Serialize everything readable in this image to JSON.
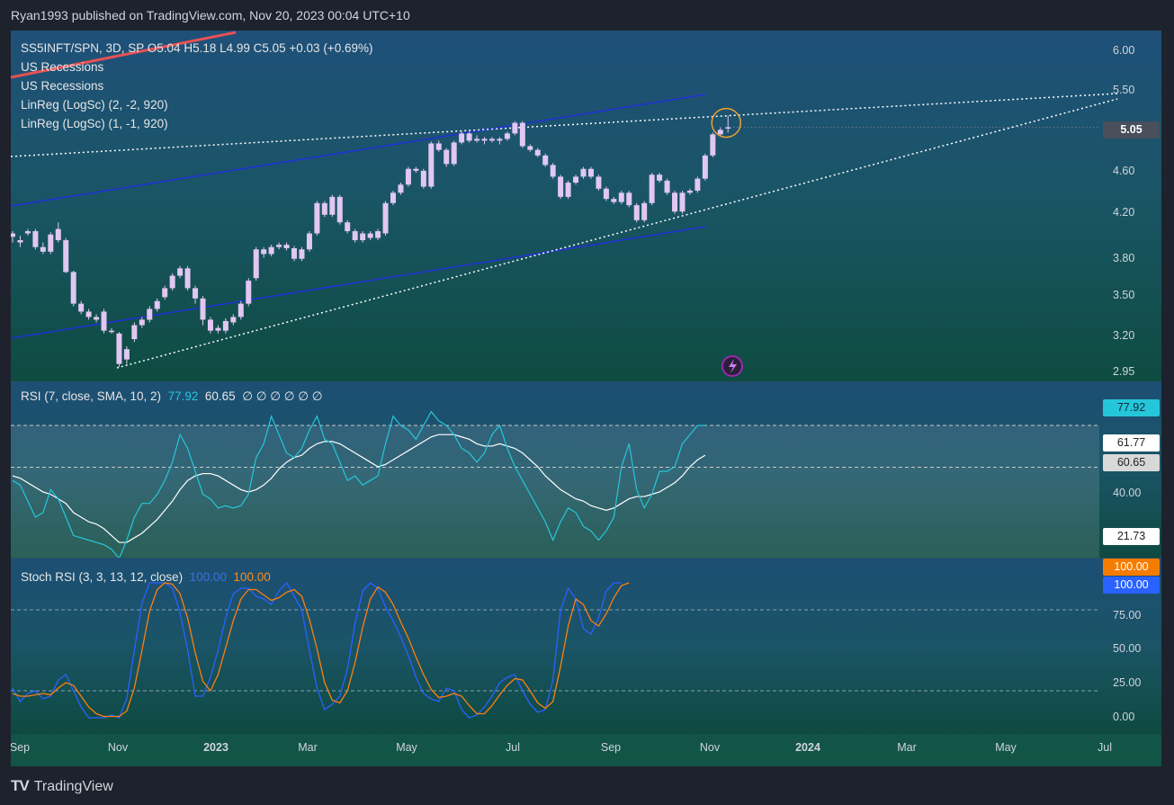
{
  "header": {
    "publisher_line": "Ryan1993 published on TradingView.com, Nov 20, 2023 00:04 UTC+10"
  },
  "footer": {
    "brand": "TradingView",
    "brand_icon": "tradingview-logo-icon"
  },
  "colors": {
    "candle": "#e1c7f2",
    "channel": "#2130d8",
    "trend": "#ffffff",
    "rsi": "#26c6da",
    "rsi_ma": "#ffffff",
    "stoch_k": "#2962ff",
    "stoch_d": "#ff7f0e",
    "recession": "#ff5252"
  },
  "price_legend": {
    "line1": "SS5INFT/SPN, 3D, SP  O5.04  H5.18  L4.99  C5.05  +0.03 (+0.69%)",
    "line2": "US Recessions",
    "line3": "US Recessions",
    "line4": "LinReg (LogSc) (2, -2, 920)",
    "line5": "LinReg (LogSc) (1, -1, 920)"
  },
  "rsi_legend": {
    "name": "RSI (7, close, SMA, 10, 2)",
    "v1": "77.92",
    "v2": "60.65",
    "rest": "∅  ∅  ∅  ∅  ∅  ∅"
  },
  "stoch_legend": {
    "name": "Stoch RSI (3, 3, 13, 12, close)",
    "v1": "100.00",
    "v2": "100.00"
  },
  "x_axis": [
    "Sep",
    "Nov",
    "2023",
    "Mar",
    "May",
    "Jul",
    "Sep",
    "Nov",
    "2024",
    "Mar",
    "May",
    "Jul"
  ],
  "price_axis": [
    "6.00",
    "5.50",
    "4.60",
    "4.20",
    "3.80",
    "3.50",
    "3.20",
    "2.95"
  ],
  "price_badge": "5.05",
  "rsi_axis": [
    "40.00"
  ],
  "rsi_badges": [
    "77.92",
    "61.77",
    "60.65",
    "21.73"
  ],
  "stoch_axis": [
    "75.00",
    "50.00",
    "25.00",
    "0.00"
  ],
  "stoch_badges": [
    "100.00",
    "100.00"
  ],
  "chart_data": [
    {
      "type": "candlestick",
      "title": "SS5INFT/SPN, 3D, SP",
      "scale": "log",
      "ylim": [
        2.9,
        6.2
      ],
      "candles": [
        {
          "o": 3.95,
          "c": 3.98,
          "h": 4.0,
          "l": 3.9
        },
        {
          "o": 3.92,
          "c": 3.9,
          "h": 3.96,
          "l": 3.86
        },
        {
          "o": 3.98,
          "c": 4.0,
          "h": 4.02,
          "l": 3.96
        },
        {
          "o": 4.0,
          "c": 3.86,
          "h": 4.02,
          "l": 3.84
        },
        {
          "o": 3.86,
          "c": 3.82,
          "h": 3.9,
          "l": 3.8
        },
        {
          "o": 3.82,
          "c": 3.97,
          "h": 3.99,
          "l": 3.8
        },
        {
          "o": 4.02,
          "c": 3.92,
          "h": 4.08,
          "l": 3.9
        },
        {
          "o": 3.92,
          "c": 3.65,
          "h": 3.94,
          "l": 3.64
        },
        {
          "o": 3.65,
          "c": 3.4,
          "h": 3.66,
          "l": 3.38
        },
        {
          "o": 3.4,
          "c": 3.34,
          "h": 3.42,
          "l": 3.32
        },
        {
          "o": 3.34,
          "c": 3.3,
          "h": 3.36,
          "l": 3.28
        },
        {
          "o": 3.3,
          "c": 3.28,
          "h": 3.32,
          "l": 3.26
        },
        {
          "o": 3.34,
          "c": 3.2,
          "h": 3.36,
          "l": 3.18
        },
        {
          "o": 3.2,
          "c": 3.19,
          "h": 3.22,
          "l": 3.18
        },
        {
          "o": 3.18,
          "c": 2.97,
          "h": 3.19,
          "l": 2.95
        },
        {
          "o": 3.0,
          "c": 3.07,
          "h": 3.09,
          "l": 2.97
        },
        {
          "o": 3.14,
          "c": 3.24,
          "h": 3.26,
          "l": 3.12
        },
        {
          "o": 3.24,
          "c": 3.28,
          "h": 3.3,
          "l": 3.22
        },
        {
          "o": 3.28,
          "c": 3.36,
          "h": 3.38,
          "l": 3.26
        },
        {
          "o": 3.36,
          "c": 3.42,
          "h": 3.44,
          "l": 3.34
        },
        {
          "o": 3.45,
          "c": 3.52,
          "h": 3.54,
          "l": 3.43
        },
        {
          "o": 3.52,
          "c": 3.62,
          "h": 3.64,
          "l": 3.5
        },
        {
          "o": 3.62,
          "c": 3.68,
          "h": 3.7,
          "l": 3.6
        },
        {
          "o": 3.68,
          "c": 3.52,
          "h": 3.7,
          "l": 3.5
        },
        {
          "o": 3.52,
          "c": 3.44,
          "h": 3.54,
          "l": 3.4
        },
        {
          "o": 3.44,
          "c": 3.28,
          "h": 3.46,
          "l": 3.24
        },
        {
          "o": 3.28,
          "c": 3.2,
          "h": 3.3,
          "l": 3.18
        },
        {
          "o": 3.2,
          "c": 3.22,
          "h": 3.24,
          "l": 3.18
        },
        {
          "o": 3.2,
          "c": 3.27,
          "h": 3.29,
          "l": 3.18
        },
        {
          "o": 3.26,
          "c": 3.3,
          "h": 3.32,
          "l": 3.24
        },
        {
          "o": 3.3,
          "c": 3.4,
          "h": 3.42,
          "l": 3.28
        },
        {
          "o": 3.4,
          "c": 3.58,
          "h": 3.6,
          "l": 3.38
        },
        {
          "o": 3.6,
          "c": 3.84,
          "h": 3.86,
          "l": 3.58
        },
        {
          "o": 3.84,
          "c": 3.8,
          "h": 3.86,
          "l": 3.77
        },
        {
          "o": 3.8,
          "c": 3.86,
          "h": 3.88,
          "l": 3.78
        },
        {
          "o": 3.86,
          "c": 3.88,
          "h": 3.9,
          "l": 3.84
        },
        {
          "o": 3.88,
          "c": 3.85,
          "h": 3.9,
          "l": 3.83
        },
        {
          "o": 3.85,
          "c": 3.76,
          "h": 3.87,
          "l": 3.74
        },
        {
          "o": 3.76,
          "c": 3.84,
          "h": 3.86,
          "l": 3.74
        },
        {
          "o": 3.84,
          "c": 3.98,
          "h": 4.0,
          "l": 3.82
        },
        {
          "o": 3.98,
          "c": 4.26,
          "h": 4.28,
          "l": 3.96
        },
        {
          "o": 4.26,
          "c": 4.15,
          "h": 4.28,
          "l": 4.13
        },
        {
          "o": 4.15,
          "c": 4.32,
          "h": 4.34,
          "l": 4.13
        },
        {
          "o": 4.32,
          "c": 4.08,
          "h": 4.34,
          "l": 4.06
        },
        {
          "o": 4.08,
          "c": 4.0,
          "h": 4.1,
          "l": 3.98
        },
        {
          "o": 4.0,
          "c": 3.92,
          "h": 4.02,
          "l": 3.9
        },
        {
          "o": 3.92,
          "c": 3.98,
          "h": 4.0,
          "l": 3.9
        },
        {
          "o": 3.98,
          "c": 3.94,
          "h": 4.0,
          "l": 3.92
        },
        {
          "o": 3.94,
          "c": 4.0,
          "h": 4.02,
          "l": 3.92
        },
        {
          "o": 3.98,
          "c": 4.26,
          "h": 4.28,
          "l": 3.96
        },
        {
          "o": 4.26,
          "c": 4.36,
          "h": 4.38,
          "l": 4.24
        },
        {
          "o": 4.36,
          "c": 4.44,
          "h": 4.46,
          "l": 4.34
        },
        {
          "o": 4.44,
          "c": 4.6,
          "h": 4.62,
          "l": 4.42
        },
        {
          "o": 4.6,
          "c": 4.58,
          "h": 4.62,
          "l": 4.56
        },
        {
          "o": 4.58,
          "c": 4.42,
          "h": 4.6,
          "l": 4.4
        },
        {
          "o": 4.42,
          "c": 4.87,
          "h": 4.89,
          "l": 4.4
        },
        {
          "o": 4.87,
          "c": 4.8,
          "h": 4.9,
          "l": 4.78
        },
        {
          "o": 4.8,
          "c": 4.65,
          "h": 4.82,
          "l": 4.62
        },
        {
          "o": 4.65,
          "c": 4.88,
          "h": 4.9,
          "l": 4.63
        },
        {
          "o": 4.88,
          "c": 4.98,
          "h": 5.0,
          "l": 4.86
        },
        {
          "o": 4.98,
          "c": 4.9,
          "h": 5.0,
          "l": 4.88
        },
        {
          "o": 4.9,
          "c": 4.92,
          "h": 4.96,
          "l": 4.88
        },
        {
          "o": 4.92,
          "c": 4.9,
          "h": 4.94,
          "l": 4.86
        },
        {
          "o": 4.9,
          "c": 4.92,
          "h": 4.94,
          "l": 4.88
        },
        {
          "o": 4.92,
          "c": 4.9,
          "h": 4.94,
          "l": 4.86
        },
        {
          "o": 4.92,
          "c": 4.98,
          "h": 5.0,
          "l": 4.9
        },
        {
          "o": 4.98,
          "c": 5.1,
          "h": 5.12,
          "l": 4.96
        },
        {
          "o": 5.1,
          "c": 4.84,
          "h": 5.12,
          "l": 4.82
        },
        {
          "o": 4.84,
          "c": 4.8,
          "h": 4.86,
          "l": 4.78
        },
        {
          "o": 4.8,
          "c": 4.74,
          "h": 4.82,
          "l": 4.72
        },
        {
          "o": 4.74,
          "c": 4.64,
          "h": 4.76,
          "l": 4.62
        },
        {
          "o": 4.64,
          "c": 4.52,
          "h": 4.66,
          "l": 4.5
        },
        {
          "o": 4.52,
          "c": 4.32,
          "h": 4.54,
          "l": 4.3
        },
        {
          "o": 4.32,
          "c": 4.46,
          "h": 4.48,
          "l": 4.3
        },
        {
          "o": 4.46,
          "c": 4.52,
          "h": 4.54,
          "l": 4.44
        },
        {
          "o": 4.52,
          "c": 4.6,
          "h": 4.62,
          "l": 4.5
        },
        {
          "o": 4.6,
          "c": 4.52,
          "h": 4.62,
          "l": 4.5
        },
        {
          "o": 4.52,
          "c": 4.4,
          "h": 4.54,
          "l": 4.38
        },
        {
          "o": 4.4,
          "c": 4.3,
          "h": 4.42,
          "l": 4.28
        },
        {
          "o": 4.3,
          "c": 4.27,
          "h": 4.32,
          "l": 4.25
        },
        {
          "o": 4.27,
          "c": 4.36,
          "h": 4.38,
          "l": 4.25
        },
        {
          "o": 4.36,
          "c": 4.24,
          "h": 4.38,
          "l": 4.22
        },
        {
          "o": 4.24,
          "c": 4.1,
          "h": 4.26,
          "l": 4.08
        },
        {
          "o": 4.1,
          "c": 4.26,
          "h": 4.28,
          "l": 4.08
        },
        {
          "o": 4.26,
          "c": 4.54,
          "h": 4.56,
          "l": 4.24
        },
        {
          "o": 4.54,
          "c": 4.48,
          "h": 4.56,
          "l": 4.46
        },
        {
          "o": 4.48,
          "c": 4.36,
          "h": 4.5,
          "l": 4.34
        },
        {
          "o": 4.36,
          "c": 4.18,
          "h": 4.38,
          "l": 4.16
        },
        {
          "o": 4.18,
          "c": 4.36,
          "h": 4.38,
          "l": 4.16
        },
        {
          "o": 4.36,
          "c": 4.38,
          "h": 4.4,
          "l": 4.34
        },
        {
          "o": 4.38,
          "c": 4.5,
          "h": 4.52,
          "l": 4.36
        },
        {
          "o": 4.5,
          "c": 4.74,
          "h": 4.76,
          "l": 4.48
        },
        {
          "o": 4.74,
          "c": 4.97,
          "h": 4.99,
          "l": 4.72
        },
        {
          "o": 4.97,
          "c": 5.02,
          "h": 5.05,
          "l": 4.95
        },
        {
          "o": 5.04,
          "c": 5.05,
          "h": 5.18,
          "l": 4.99
        }
      ]
    },
    {
      "type": "line",
      "title": "RSI (7, close, SMA, 10, 2)",
      "ylim": [
        10,
        90
      ],
      "series": [
        {
          "name": "RSI",
          "values": [
            56,
            54,
            47,
            40,
            42,
            52,
            48,
            40,
            32,
            31,
            30,
            29,
            28,
            26,
            22,
            30,
            40,
            46,
            46,
            50,
            56,
            64,
            76,
            70,
            60,
            50,
            48,
            44,
            45,
            44,
            45,
            50,
            66,
            72,
            84,
            76,
            68,
            66,
            70,
            78,
            84,
            74,
            72,
            64,
            56,
            58,
            54,
            56,
            58,
            72,
            84,
            80,
            78,
            74,
            80,
            86,
            82,
            80,
            76,
            70,
            68,
            64,
            68,
            76,
            80,
            70,
            62,
            56,
            50,
            44,
            38,
            30,
            38,
            44,
            42,
            36,
            34,
            30,
            34,
            40,
            62,
            72,
            52,
            44,
            50,
            60,
            60,
            62,
            72,
            76,
            80,
            80
          ]
        },
        {
          "name": "RSI MA",
          "values": [
            58,
            57,
            55,
            53,
            51,
            50,
            48,
            46,
            42,
            40,
            38,
            37,
            35,
            32,
            29,
            29,
            31,
            33,
            36,
            39,
            43,
            47,
            52,
            56,
            58,
            59,
            59,
            58,
            56,
            54,
            52,
            51,
            52,
            54,
            57,
            61,
            64,
            66,
            67,
            70,
            72,
            73,
            73,
            72,
            70,
            68,
            66,
            64,
            62,
            63,
            65,
            67,
            69,
            71,
            73,
            75,
            76,
            76,
            76,
            75,
            74,
            72,
            71,
            71,
            72,
            71,
            70,
            68,
            65,
            62,
            58,
            55,
            52,
            50,
            48,
            47,
            45,
            44,
            43,
            44,
            46,
            48,
            49,
            49,
            50,
            51,
            53,
            55,
            58,
            62,
            65,
            67
          ]
        }
      ]
    },
    {
      "type": "line",
      "title": "Stoch RSI (3, 3, 13, 12, close)",
      "ylim": [
        -8,
        108
      ],
      "series": [
        {
          "name": "K",
          "values": [
            22,
            12,
            18,
            20,
            14,
            16,
            28,
            32,
            20,
            8,
            0,
            0,
            0,
            2,
            0,
            14,
            50,
            85,
            100,
            100,
            100,
            96,
            78,
            50,
            16,
            16,
            30,
            50,
            74,
            92,
            96,
            96,
            90,
            88,
            84,
            94,
            100,
            90,
            80,
            50,
            22,
            6,
            10,
            16,
            36,
            70,
            94,
            100,
            96,
            82,
            72,
            60,
            46,
            30,
            18,
            14,
            12,
            22,
            20,
            6,
            0,
            2,
            8,
            16,
            26,
            30,
            32,
            20,
            10,
            4,
            6,
            28,
            80,
            96,
            88,
            66,
            62,
            74,
            94,
            100,
            100
          ]
        },
        {
          "name": "D",
          "values": [
            18,
            16,
            16,
            17,
            18,
            17,
            22,
            26,
            24,
            16,
            8,
            3,
            1,
            1,
            1,
            5,
            22,
            50,
            79,
            95,
            100,
            99,
            92,
            74,
            48,
            27,
            20,
            32,
            52,
            72,
            88,
            95,
            95,
            91,
            87,
            89,
            93,
            95,
            90,
            73,
            51,
            26,
            13,
            11,
            20,
            41,
            67,
            88,
            97,
            93,
            84,
            71,
            59,
            45,
            32,
            21,
            15,
            16,
            18,
            16,
            9,
            3,
            3,
            9,
            17,
            24,
            29,
            28,
            20,
            11,
            7,
            12,
            38,
            68,
            88,
            84,
            72,
            68,
            77,
            89,
            98,
            100
          ]
        }
      ]
    }
  ]
}
